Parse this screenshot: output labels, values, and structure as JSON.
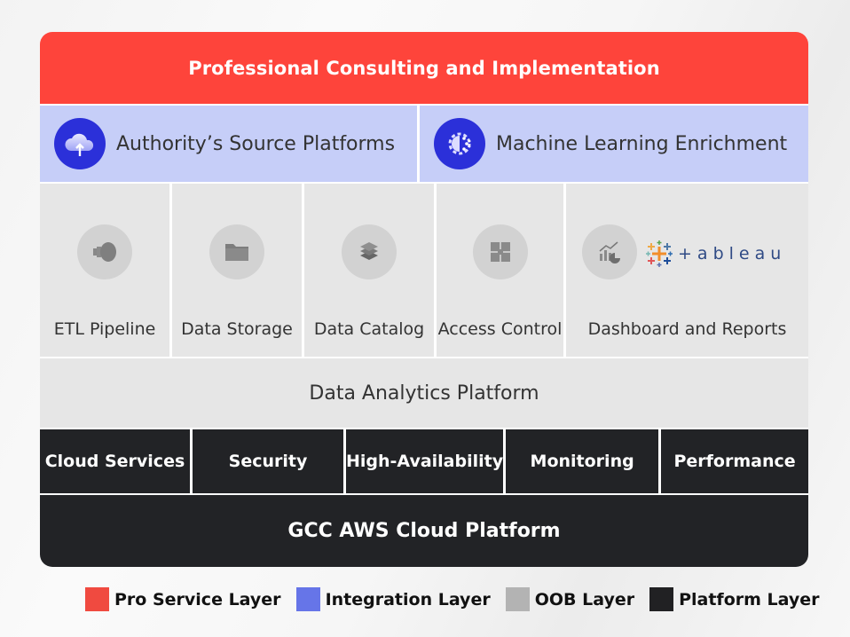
{
  "pro_service": {
    "title": "Professional Consulting and Implementation"
  },
  "integration": [
    {
      "label": "Authority’s Source Platforms",
      "icon": "cloud-upload-icon"
    },
    {
      "label": "Machine Learning Enrichment",
      "icon": "ai-gear-icon"
    }
  ],
  "oob": [
    {
      "label": "ETL Pipeline",
      "icon": "pipeline-icon"
    },
    {
      "label": "Data Storage",
      "icon": "folder-icon"
    },
    {
      "label": "Data Catalog",
      "icon": "layers-icon"
    },
    {
      "label": "Access Control",
      "icon": "puzzle-icon"
    },
    {
      "label": "Dashboard and Reports",
      "icon": "chart-icon",
      "logo_text": "+ableau"
    }
  ],
  "data_analytics": {
    "title": "Data Analytics Platform"
  },
  "platform_services": [
    {
      "label": "Cloud Services"
    },
    {
      "label": "Security"
    },
    {
      "label": "High-Availability"
    },
    {
      "label": "Monitoring"
    },
    {
      "label": "Performance"
    }
  ],
  "cloud_platform": {
    "title": "GCC AWS Cloud Platform"
  },
  "legend": [
    {
      "label": "Pro Service Layer",
      "color": "#f04a40"
    },
    {
      "label": "Integration Layer",
      "color": "#6675e8"
    },
    {
      "label": "OOB Layer",
      "color": "#b3b3b3"
    },
    {
      "label": "Platform Layer",
      "color": "#212123"
    }
  ]
}
